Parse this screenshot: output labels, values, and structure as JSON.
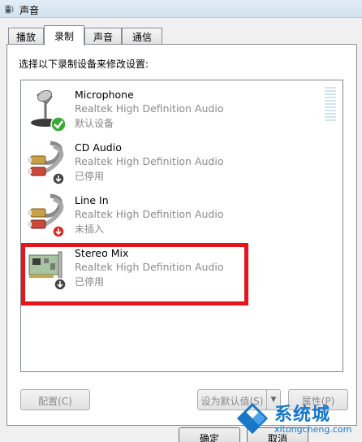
{
  "window": {
    "title": "声音",
    "icon": "speaker-icon"
  },
  "tabs": [
    {
      "label": "播放",
      "active": false
    },
    {
      "label": "录制",
      "active": true
    },
    {
      "label": "声音",
      "active": false
    },
    {
      "label": "通信",
      "active": false
    }
  ],
  "panel": {
    "instruction": "选择以下录制设备来修改设置:"
  },
  "devices": [
    {
      "name": "Microphone",
      "driver": "Realtek High Definition Audio",
      "status": "默认设备",
      "icon": "microphone-icon",
      "badge": "default-check-icon",
      "selected": false
    },
    {
      "name": "CD Audio",
      "driver": "Realtek High Definition Audio",
      "status": "已停用",
      "icon": "audio-cable-icon",
      "badge": "disabled-arrow-icon",
      "selected": false
    },
    {
      "name": "Line In",
      "driver": "Realtek High Definition Audio",
      "status": "未插入",
      "icon": "audio-cable-icon",
      "badge": "unplugged-arrow-icon",
      "selected": false
    },
    {
      "name": "Stereo Mix",
      "driver": "Realtek High Definition Audio",
      "status": "已停用",
      "icon": "sound-card-icon",
      "badge": "disabled-arrow-icon",
      "selected": false,
      "highlighted": true
    }
  ],
  "buttons": {
    "configure": "配置(C)",
    "set_default": "设为默认值(S)",
    "properties": "属性(P)",
    "ok": "确定",
    "cancel": "取消"
  },
  "watermark": {
    "brand": "系统城",
    "url": "xitongcheng.com"
  },
  "colors": {
    "highlight_box": "#e8141c",
    "watermark": "#1677c9",
    "check_badge": "#3aa935",
    "disabled_badge": "#444444",
    "unplugged_badge": "#d9261c"
  }
}
